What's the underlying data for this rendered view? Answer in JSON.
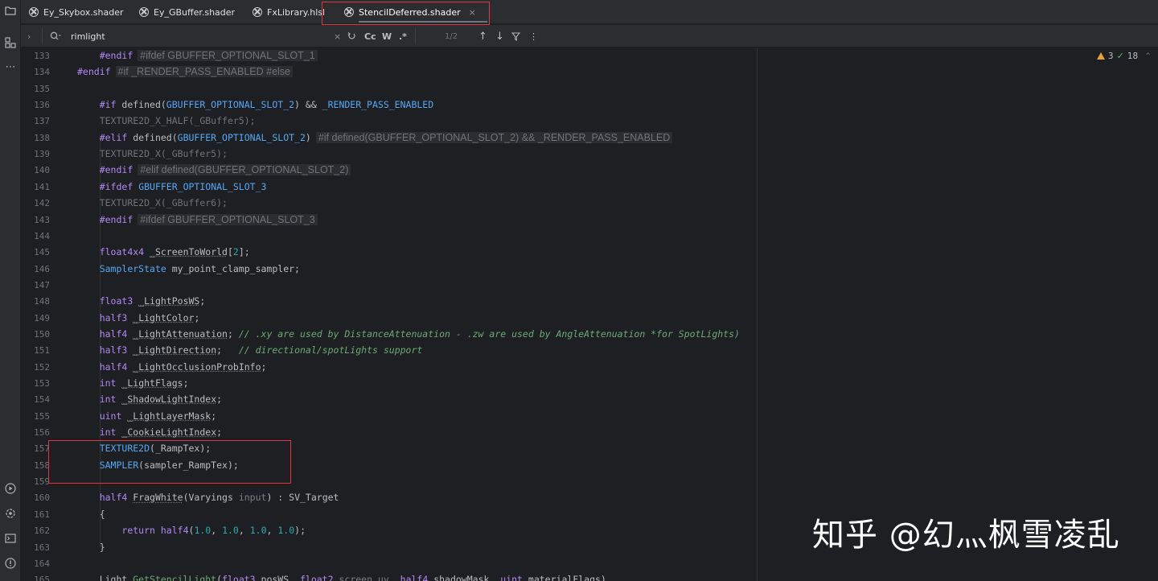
{
  "tabs": [
    {
      "label": "Ey_Skybox.shader",
      "active": false
    },
    {
      "label": "Ey_GBuffer.shader",
      "active": false
    },
    {
      "label": "FxLibrary.hlsl",
      "active": false
    },
    {
      "label": "StencilDeferred.shader",
      "active": true
    }
  ],
  "tab_close_glyph": "×",
  "search": {
    "query": "rimlight",
    "clear_glyph": "×",
    "match_case": "Cc",
    "whole_words": "W",
    "regex": ".*",
    "result_count": "1/2",
    "prev_glyph": "↑",
    "next_glyph": "↓",
    "more_glyph": "⋮",
    "expand_glyph": "›"
  },
  "inspections": {
    "warnings": "3",
    "ok": "18"
  },
  "lines": [
    {
      "n": "133",
      "html": "    <span class='dir'>#endif</span><span class='ann'>#ifdef GBUFFER_OPTIONAL_SLOT_1</span>"
    },
    {
      "n": "134",
      "html": "<span class='dir'>#endif</span><span class='ann'>#if _RENDER_PASS_ENABLED #else</span>"
    },
    {
      "n": "135",
      "html": ""
    },
    {
      "n": "136",
      "html": "    <span class='dir'>#if</span> defined(<span class='macro'>GBUFFER_OPTIONAL_SLOT_2</span>) &amp;&amp; <span class='macro'>_RENDER_PASS_ENABLED</span>"
    },
    {
      "n": "137",
      "html": "    <span class='inact'>TEXTURE2D_X_HALF(_GBuffer5);</span>"
    },
    {
      "n": "138",
      "html": "    <span class='dir'>#elif</span> defined(<span class='macro'>GBUFFER_OPTIONAL_SLOT_2</span>)<span class='ann'>#if defined(GBUFFER_OPTIONAL_SLOT_2) &amp;&amp; _RENDER_PASS_ENABLED</span>"
    },
    {
      "n": "139",
      "html": "    <span class='inact'>TEXTURE2D_X(_GBuffer5);</span>"
    },
    {
      "n": "140",
      "html": "    <span class='dir'>#endif</span><span class='ann'>#elif defined(GBUFFER_OPTIONAL_SLOT_2)</span>"
    },
    {
      "n": "141",
      "html": "    <span class='dir'>#ifdef</span> <span class='macro'>GBUFFER_OPTIONAL_SLOT_3</span>"
    },
    {
      "n": "142",
      "html": "    <span class='inact'>TEXTURE2D_X(_GBuffer6);</span>"
    },
    {
      "n": "143",
      "html": "    <span class='dir'>#endif</span><span class='ann'>#ifdef GBUFFER_OPTIONAL_SLOT_3</span>"
    },
    {
      "n": "144",
      "html": ""
    },
    {
      "n": "145",
      "html": "    <span class='dir'>float4x4</span> <span class='ident'>_ScreenToWorld</span>[<span class='num'>2</span>];"
    },
    {
      "n": "146",
      "html": "    <span class='macro'>SamplerState</span> my_point_clamp_sampler;"
    },
    {
      "n": "147",
      "html": ""
    },
    {
      "n": "148",
      "html": "    <span class='dir'>float3</span> <span class='ident'>_LightPosWS</span>;"
    },
    {
      "n": "149",
      "html": "    <span class='dir'>half3</span> <span class='ident'>_LightColor</span>;"
    },
    {
      "n": "150",
      "html": "    <span class='dir'>half4</span> <span class='ident'>_LightAttenuation</span>; <span class='cmt'>// .xy are used by DistanceAttenuation - .zw are used by AngleAttenuation *for SpotLights)</span>"
    },
    {
      "n": "151",
      "html": "    <span class='dir'>half3</span> <span class='ident'>_LightDirection</span>;   <span class='cmt'>// directional/spotLights support</span>"
    },
    {
      "n": "152",
      "html": "    <span class='dir'>half4</span> <span class='ident'>_LightOcclusionProbInfo</span>;"
    },
    {
      "n": "153",
      "html": "    <span class='dir'>int</span> <span class='ident'>_LightFlags</span>;"
    },
    {
      "n": "154",
      "html": "    <span class='dir'>int</span> <span class='ident'>_ShadowLightIndex</span>;"
    },
    {
      "n": "155",
      "html": "    <span class='dir'>uint</span> <span class='ident'>_LightLayerMask</span>;"
    },
    {
      "n": "156",
      "html": "    <span class='dir'>int</span> <span class='ident'>_CookieLightIndex</span>;"
    },
    {
      "n": "157",
      "html": "    <span class='macro'>TEXTURE2D</span>(_RampTex);"
    },
    {
      "n": "158",
      "html": "    <span class='macro'>SAMPLER</span>(sampler_RampTex);"
    },
    {
      "n": "159",
      "html": ""
    },
    {
      "n": "160",
      "html": "    <span class='dir'>half4</span> <span class='ident'>FragWhite</span>(Varyings <span class='param'>input</span>) : SV_Target"
    },
    {
      "n": "161",
      "html": "    {"
    },
    {
      "n": "162",
      "html": "        <span class='dir'>return</span> <span class='dir'>half4</span>(<span class='num'>1.0</span>, <span class='num'>1.0</span>, <span class='num'>1.0</span>, <span class='num'>1.0</span>);"
    },
    {
      "n": "163",
      "html": "    }"
    },
    {
      "n": "164",
      "html": ""
    },
    {
      "n": "165",
      "html": "    Light <span class='typ'>GetStencilLight</span>(<span class='dir'>float3</span> posWS, <span class='dir'>float2</span> <span class='param'>screen_uv</span>, <span class='dir'>half4</span> shadowMask, <span class='dir'>uint</span> materialFlags)"
    }
  ],
  "watermark": "知乎 @幻灬枫雪凌乱"
}
